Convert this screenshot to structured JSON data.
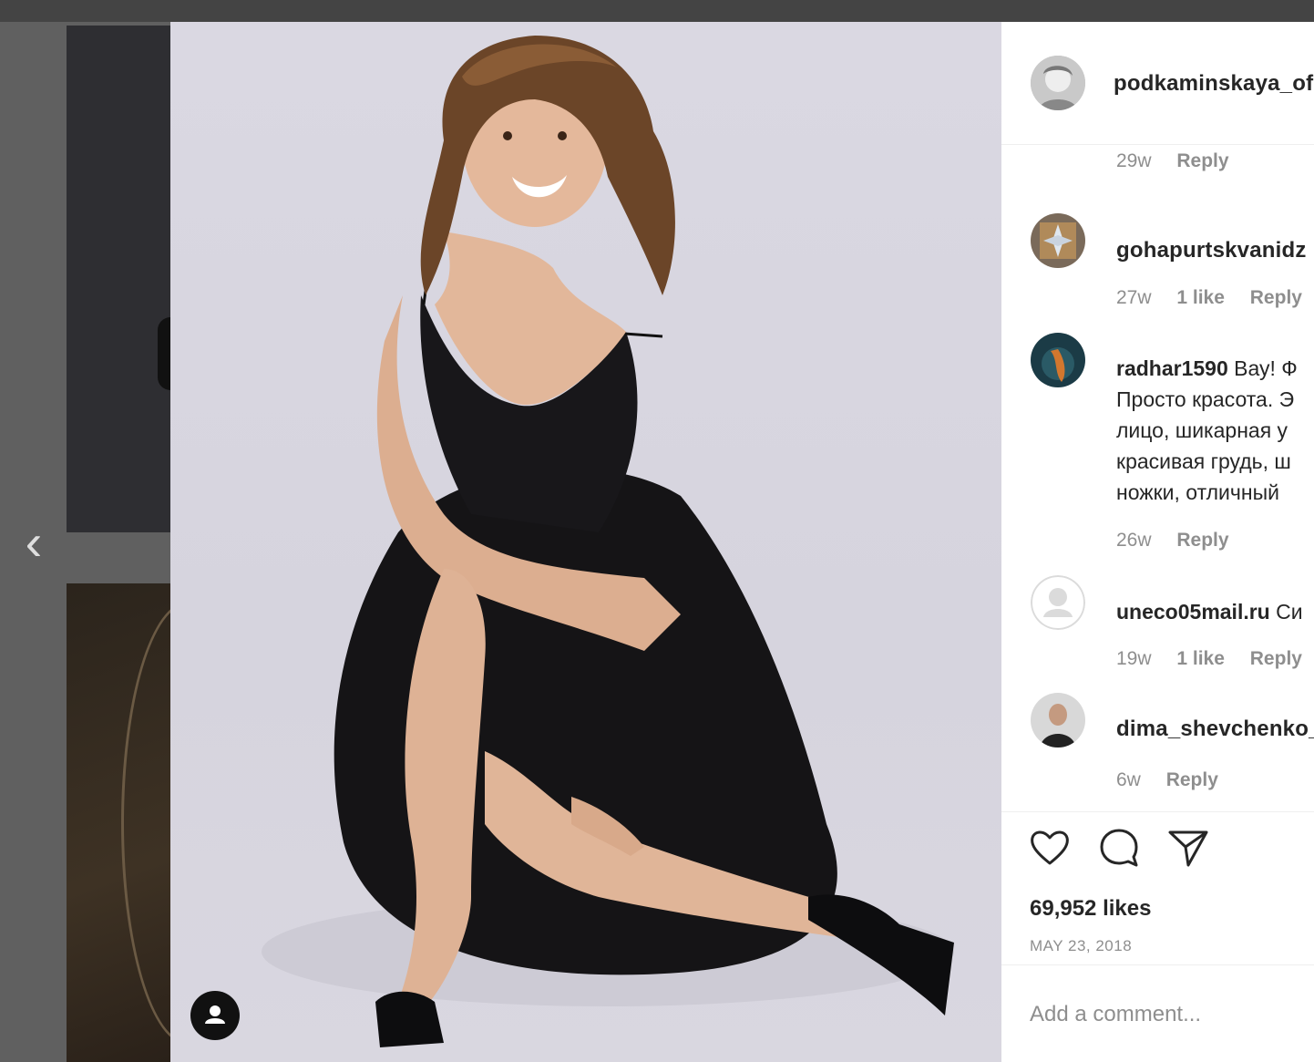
{
  "post": {
    "username": "podkaminskaya_of",
    "likes_text": "69,952 likes",
    "date": "MAY 23, 2018",
    "comment_placeholder": "Add a comment..."
  },
  "comments": [
    {
      "username": "",
      "text": "",
      "time": "29w",
      "likes": "",
      "reply": "Reply"
    },
    {
      "username": "gohapurtskvanidz",
      "text": "",
      "time": "27w",
      "likes": "1 like",
      "reply": "Reply"
    },
    {
      "username": "radhar1590",
      "text_lines": [
        "Вау! Ф",
        "Просто красота. Э",
        "лицо, шикарная у",
        "красивая грудь, ш",
        "ножки, отличный"
      ],
      "time": "26w",
      "likes": "",
      "reply": "Reply"
    },
    {
      "username": "uneco05mail.ru",
      "text": "Си",
      "time": "19w",
      "likes": "1 like",
      "reply": "Reply"
    },
    {
      "username": "dima_shevchenko_",
      "text": "",
      "time": "6w",
      "likes": "",
      "reply": "Reply"
    }
  ],
  "icons": {
    "prev": "chevron-left-icon",
    "like": "heart-icon",
    "comment": "comment-bubble-icon",
    "share": "paper-plane-icon",
    "user_tag": "user-icon"
  },
  "colors": {
    "text": "#262626",
    "muted": "#8e8e8e",
    "panel_bg": "#ffffff",
    "overlay_bg": "#5b5b5b"
  }
}
